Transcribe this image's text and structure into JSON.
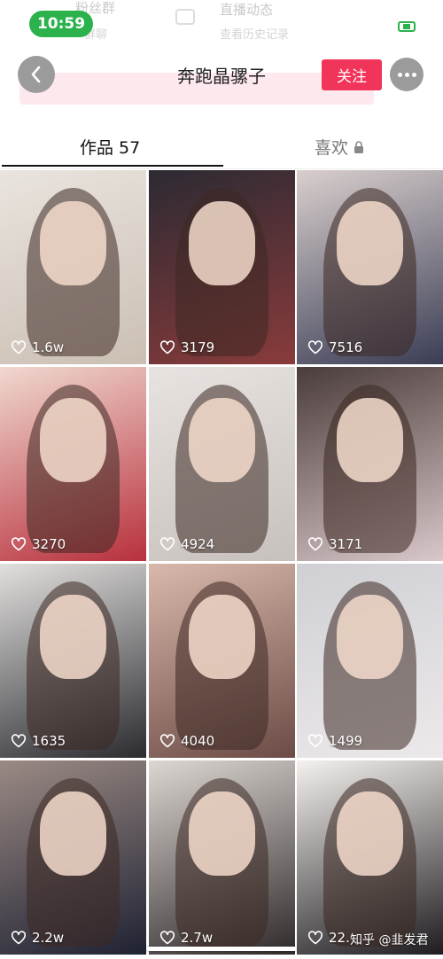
{
  "status_bar": {
    "time": "10:59"
  },
  "background_overlay": {
    "fans_group": "粉丝群",
    "fans_group_sub": "群聊",
    "live_updates": "直播动态",
    "live_updates_sub": "查看历史记录"
  },
  "header": {
    "title": "奔跑晶骡子",
    "follow_label": "关注"
  },
  "tabs": {
    "works_label": "作品 57",
    "likes_label": "喜欢"
  },
  "videos": [
    {
      "likes": "1.6w"
    },
    {
      "likes": "3179"
    },
    {
      "likes": "7516"
    },
    {
      "likes": "3270"
    },
    {
      "likes": "4924"
    },
    {
      "likes": "3171"
    },
    {
      "likes": "1635"
    },
    {
      "likes": "4040"
    },
    {
      "likes": "1499"
    },
    {
      "likes": "2.2w"
    },
    {
      "likes": "2.7w"
    },
    {
      "likes": "22."
    }
  ],
  "watermark": "知乎 @韭发君",
  "colors": {
    "accent": "#f1345a",
    "status_green": "#2bb24c"
  }
}
